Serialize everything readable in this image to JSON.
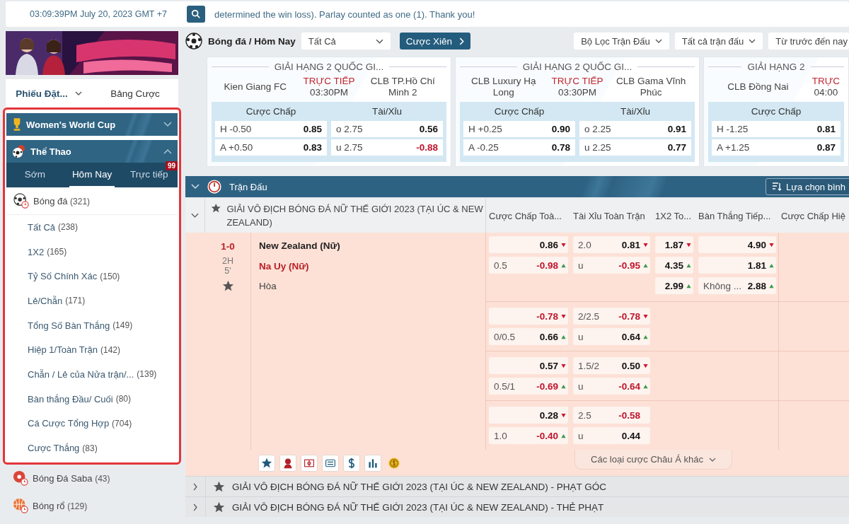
{
  "top_bar": {
    "datetime": "03:09:39PM July 20, 2023 GMT +7",
    "ticker": "determined the win loss). Parlay counted as one (1). Thank you!"
  },
  "sidebar": {
    "bet_tabs": [
      {
        "label": "Phiếu Đặt...",
        "selected": true
      },
      {
        "label": "Bảng Cược",
        "selected": false
      }
    ],
    "promo": {
      "label": "Women's World Cup",
      "expanded": false
    },
    "sports_panel": {
      "label": "Thể Thao",
      "expanded": true,
      "tabs": [
        {
          "label": "Sớm",
          "selected": false
        },
        {
          "label": "Hôm Nay",
          "selected": true
        },
        {
          "label": "Trực tiếp",
          "selected": false,
          "badge": "99"
        }
      ],
      "sport": {
        "name": "Bóng đá",
        "count": "(321)"
      },
      "markets": [
        {
          "name": "Tất Cả",
          "count": "(238)"
        },
        {
          "name": "1X2",
          "count": "(165)"
        },
        {
          "name": "Tỷ Số Chính Xác",
          "count": "(150)"
        },
        {
          "name": "Lẻ/Chẵn",
          "count": "(171)"
        },
        {
          "name": "Tổng Số Bàn Thắng",
          "count": "(149)"
        },
        {
          "name": "Hiệp 1/Toàn Trận",
          "count": "(142)"
        },
        {
          "name": "Chẵn / Lẻ của Nửa trận/...",
          "count": "(139)"
        },
        {
          "name": "Bàn thắng Đầu/ Cuối",
          "count": "(80)"
        },
        {
          "name": "Cá Cược Tổng Hợp",
          "count": "(704)"
        },
        {
          "name": "Cược Thắng",
          "count": "(83)"
        }
      ]
    },
    "other_sports": [
      {
        "name": "Bóng Đá Saba",
        "count": "(43)",
        "kind": "saba"
      },
      {
        "name": "Bóng rổ",
        "count": "(129)",
        "kind": "basketball"
      }
    ]
  },
  "main": {
    "filter_bar": {
      "title": "Bóng đá / Hôm Nay",
      "market_select": "Tất Cả",
      "parlay_button": "Cược Xiên",
      "filters": [
        {
          "label": "Bộ Lọc Trận Đấu",
          "dropdown": true
        },
        {
          "label": "Tất cả trận đấu",
          "dropdown": true
        },
        {
          "label": "Từ trước đến nay",
          "dropdown": false
        }
      ]
    },
    "cards": [
      {
        "league": "GIẢI HẠNG 2 QUỐC GI...",
        "home": "Kien Giang FC",
        "status": "TRỰC TIẾP",
        "time": "03:30PM",
        "away": "CLB TP.Hồ Chí Minh 2",
        "handicap": {
          "title": "Cược Chấp",
          "rows": [
            {
              "side": "H",
              "line": "-0.50",
              "odds": "0.85",
              "negative": false
            },
            {
              "side": "A",
              "line": "+0.50",
              "odds": "0.83",
              "negative": false
            }
          ]
        },
        "total": {
          "title": "Tài/Xỉu",
          "rows": [
            {
              "side": "o",
              "line": "2.75",
              "odds": "0.56",
              "negative": false
            },
            {
              "side": "u",
              "line": "2.75",
              "odds": "-0.88",
              "negative": true
            }
          ]
        }
      },
      {
        "league": "GIẢI HẠNG 2 QUỐC GI...",
        "home": "CLB Luxury Hạ Long",
        "status": "TRỰC TIẾP",
        "time": "03:30PM",
        "away": "CLB Gama Vĩnh Phúc",
        "handicap": {
          "title": "Cược Chấp",
          "rows": [
            {
              "side": "H",
              "line": "+0.25",
              "odds": "0.90",
              "negative": false
            },
            {
              "side": "A",
              "line": "-0.25",
              "odds": "0.78",
              "negative": false
            }
          ]
        },
        "total": {
          "title": "Tài/Xỉu",
          "rows": [
            {
              "side": "o",
              "line": "2.25",
              "odds": "0.91",
              "negative": false
            },
            {
              "side": "u",
              "line": "2.25",
              "odds": "0.77",
              "negative": false
            }
          ]
        }
      },
      {
        "league": "GIẢI HẠNG 2",
        "home": "CLB Đồng Nai",
        "status": "TRỰC",
        "time": "04:00",
        "handicap": {
          "title": "Cược Chấp",
          "rows": [
            {
              "side": "H",
              "line": "-1.25",
              "odds": "0.81",
              "negative": false
            },
            {
              "side": "A",
              "line": "+1.25",
              "odds": "0.87",
              "negative": false
            }
          ]
        }
      }
    ],
    "section": {
      "title": "Trận Đấu",
      "expanded": true,
      "sort_button": "Lựa chọn bình"
    },
    "league": {
      "name": "GIẢI VÔ ĐỊCH BÓNG ĐÁ NỮ THẾ GIỚI 2023 (TẠI ÚC & NEW ZEALAND)",
      "expanded": true,
      "favorite": false,
      "columns": [
        "Cược Chấp Toà...",
        "Tài Xỉu Toàn Trận",
        "1X2 To...",
        "Bàn Thắng Tiếp...",
        "Cược Chấp Hiệ"
      ]
    },
    "match": {
      "score": "1-0",
      "period": "2H",
      "minute": "5'",
      "favorite": false,
      "teams": [
        {
          "name": "New Zealand (Nữ)",
          "kind": "home"
        },
        {
          "name": "Na Uy (Nữ)",
          "kind": "away"
        },
        {
          "name": "Hòa",
          "kind": "draw"
        }
      ],
      "markets": [
        {
          "handicap": [
            {
              "odds": "0.86",
              "negative": false,
              "moved": true,
              "rising": false
            },
            {
              "line": "0.5",
              "odds": "-0.98",
              "negative": true,
              "moved": true,
              "rising": true
            }
          ],
          "total": [
            {
              "line": "2.0",
              "odds": "0.81",
              "negative": false,
              "moved": true,
              "rising": false
            },
            {
              "line": "u",
              "odds": "-0.95",
              "negative": true,
              "moved": true,
              "rising": true
            }
          ]
        },
        {
          "handicap": [
            {
              "odds": "-0.78",
              "negative": true,
              "moved": true,
              "rising": false
            },
            {
              "line": "0/0.5",
              "odds": "0.66",
              "negative": false,
              "moved": true,
              "rising": true
            }
          ],
          "total": [
            {
              "line": "2/2.5",
              "odds": "-0.78",
              "negative": true,
              "moved": true,
              "rising": false
            },
            {
              "line": "u",
              "odds": "0.64",
              "negative": false,
              "moved": true,
              "rising": true
            }
          ]
        },
        {
          "handicap": [
            {
              "odds": "0.57",
              "negative": false,
              "moved": true,
              "rising": false
            },
            {
              "line": "0.5/1",
              "odds": "-0.69",
              "negative": true,
              "moved": true,
              "rising": true
            }
          ],
          "total": [
            {
              "line": "1.5/2",
              "odds": "0.50",
              "negative": false,
              "moved": true,
              "rising": false
            },
            {
              "line": "u",
              "odds": "-0.64",
              "negative": true,
              "moved": true,
              "rising": true
            }
          ]
        },
        {
          "handicap": [
            {
              "odds": "0.28",
              "negative": false,
              "moved": true,
              "rising": false
            },
            {
              "line": "1.0",
              "odds": "-0.40",
              "negative": true,
              "moved": true,
              "rising": true
            }
          ],
          "total": [
            {
              "line": "2.5",
              "odds": "-0.58",
              "negative": true,
              "moved": false
            },
            {
              "line": "u",
              "odds": "0.44",
              "negative": false,
              "moved": false
            }
          ]
        }
      ],
      "x12": [
        {
          "odds": "1.87",
          "negative": false,
          "moved": true,
          "rising": false
        },
        {
          "odds": "4.35",
          "negative": false,
          "moved": true,
          "rising": true
        },
        {
          "odds": "2.99",
          "negative": false,
          "moved": true,
          "rising": true
        }
      ],
      "next_goal": [
        {
          "odds": "4.90",
          "negative": false,
          "moved": true,
          "rising": false
        },
        {
          "odds": "1.81",
          "negative": false,
          "moved": true,
          "rising": true
        },
        {
          "line": "Không ...",
          "odds": "2.88",
          "negative": false,
          "moved": true,
          "rising": true
        }
      ],
      "more_button": "Các loại cược Châu Á khác"
    },
    "collapsed_leagues": [
      {
        "name": "GIẢI VÔ ĐỊCH BÓNG ĐÁ NỮ THẾ GIỚI 2023 (TẠI ÚC & NEW ZEALAND) - PHẠT GÓC",
        "expanded": false,
        "favorite": false
      },
      {
        "name": "GIẢI VÔ ĐỊCH BÓNG ĐÁ NỮ THẾ GIỚI 2023 (TẠI ÚC & NEW ZEALAND) - THẺ PHẠT",
        "expanded": false,
        "favorite": false
      }
    ]
  }
}
